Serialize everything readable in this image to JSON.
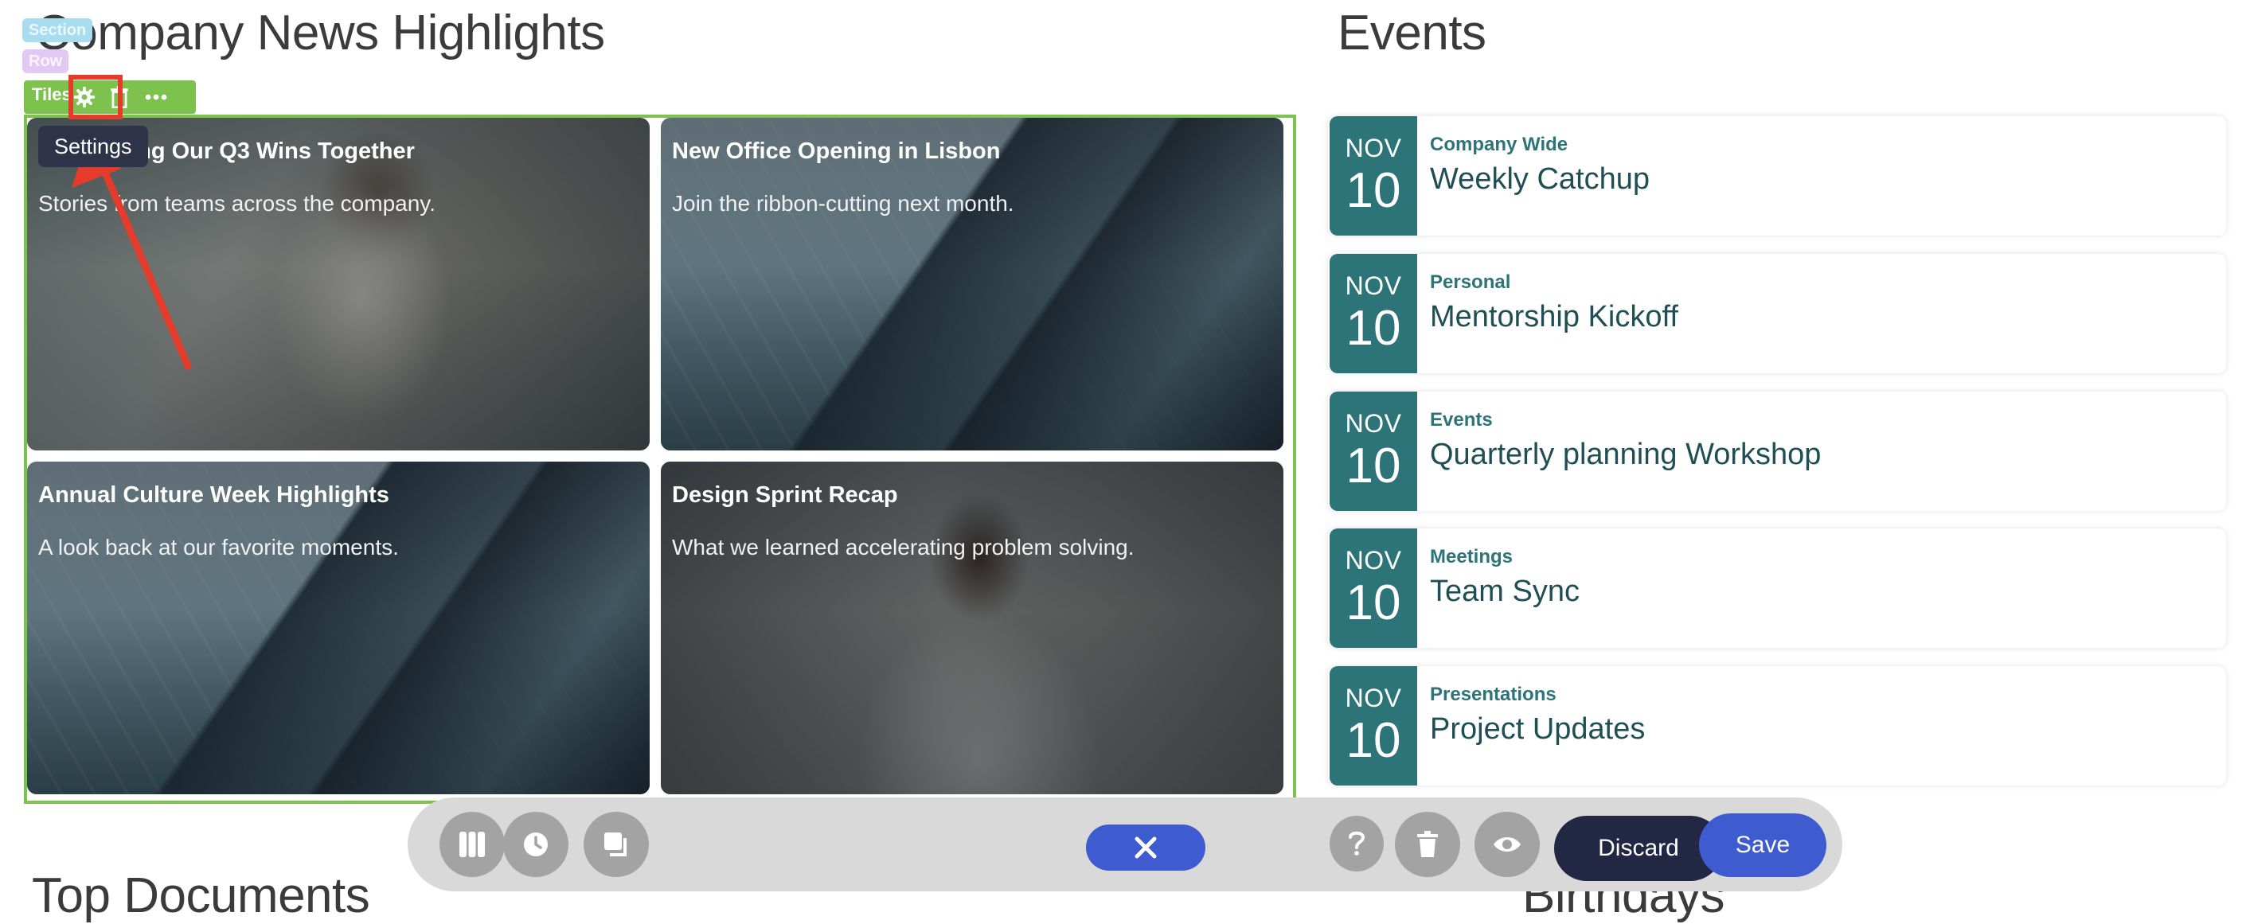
{
  "editor": {
    "section_label": "Section",
    "row_label": "Row",
    "tiles_label": "Tiles",
    "settings_tooltip": "Settings"
  },
  "news": {
    "title": "Company News Highlights",
    "tiles": [
      {
        "title": "Celebrating Our Q3 Wins Together",
        "subtitle": "Stories from teams across the company."
      },
      {
        "title": "New Office Opening in Lisbon",
        "subtitle": "Join the ribbon-cutting next month."
      },
      {
        "title": "Annual Culture Week Highlights",
        "subtitle": "A look back at our favorite moments."
      },
      {
        "title": "Design Sprint Recap",
        "subtitle": "What we learned accelerating problem solving."
      }
    ]
  },
  "events": {
    "title": "Events",
    "items": [
      {
        "month": "NOV",
        "day": "10",
        "category": "Company Wide",
        "name": "Weekly Catchup"
      },
      {
        "month": "NOV",
        "day": "10",
        "category": "Personal",
        "name": "Mentorship Kickoff"
      },
      {
        "month": "NOV",
        "day": "10",
        "category": "Events",
        "name": "Quarterly planning Workshop"
      },
      {
        "month": "NOV",
        "day": "10",
        "category": "Meetings",
        "name": "Team Sync"
      },
      {
        "month": "NOV",
        "day": "10",
        "category": "Presentations",
        "name": "Project Updates"
      }
    ]
  },
  "lower_sections": {
    "docs_title": "Top Documents",
    "birthdays_title": "Birthdays"
  },
  "bottom_bar": {
    "discard_label": "Discard",
    "save_label": "Save",
    "icons": [
      "columns-icon",
      "history-icon",
      "copy-icon",
      "close-icon",
      "help-icon",
      "trash-icon",
      "eye-icon"
    ]
  },
  "colors": {
    "accent_green": "#7cc24c",
    "event_teal": "#2d7479",
    "primary_blue": "#3f5bd0",
    "discard_navy": "#222843",
    "annotation_red": "#e53b2a"
  }
}
